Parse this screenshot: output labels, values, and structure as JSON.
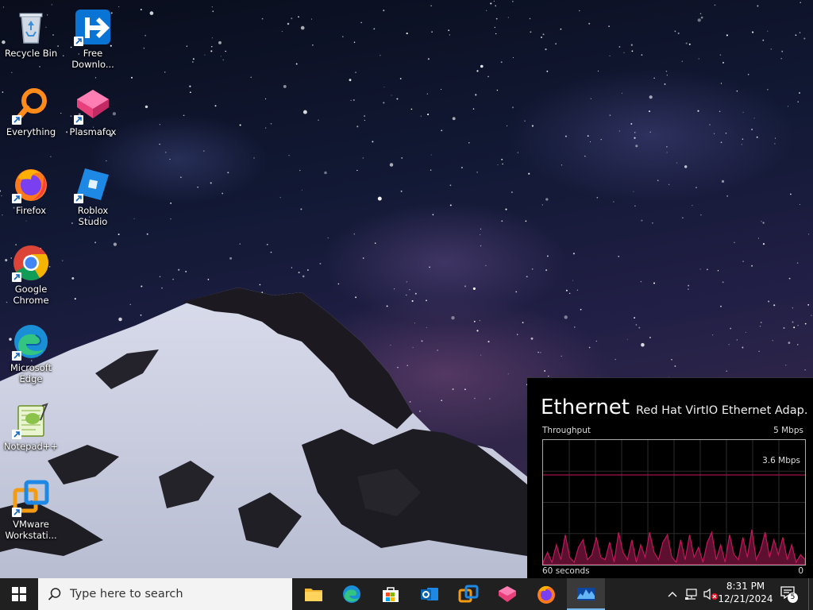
{
  "desktop_icons": [
    {
      "label": "Recycle Bin"
    },
    {
      "label": "Free Downlo..."
    },
    {
      "label": "Everything"
    },
    {
      "label": "Plasmafox"
    },
    {
      "label": "Firefox"
    },
    {
      "label": "Roblox Studio"
    },
    {
      "label": "Google Chrome"
    },
    {
      "label": "Microsoft Edge"
    },
    {
      "label": "Notepad++"
    },
    {
      "label": "VMware Workstati..."
    }
  ],
  "network_flyout": {
    "title": "Ethernet",
    "adapter": "Red Hat VirtIO Ethernet Adap...",
    "throughput_label": "Throughput",
    "max_label": "5 Mbps",
    "current_label": "3.6 Mbps",
    "time_label": "60 seconds",
    "min_label": "0",
    "scale_max_mbps": 5,
    "current_mbps": 3.6,
    "samples_mbps": [
      0.1,
      0.5,
      0.1,
      0.8,
      0.2,
      1.2,
      0.3,
      0.1,
      0.7,
      1.0,
      0.2,
      0.4,
      1.1,
      0.3,
      0.2,
      0.9,
      0.1,
      1.3,
      0.5,
      0.2,
      1.0,
      0.1,
      0.8,
      0.3,
      1.3,
      0.5,
      0.2,
      0.9,
      1.2,
      0.3,
      0.1,
      1.0,
      0.2,
      1.2,
      0.3,
      0.7,
      0.1,
      0.9,
      1.3,
      0.2,
      0.8,
      0.1,
      1.2,
      0.4,
      0.2,
      1.1,
      0.3,
      1.4,
      0.2,
      0.6,
      1.3,
      0.3,
      1.0,
      0.4,
      1.1,
      0.2,
      0.8,
      0.1,
      0.4,
      0.2
    ]
  },
  "taskbar": {
    "search_placeholder": "Type here to search",
    "pinned": [
      "File Explorer",
      "Microsoft Edge",
      "Microsoft Store",
      "Outlook",
      "VMware Workstation",
      "Plasmafox",
      "Firefox",
      "Network Monitor"
    ]
  },
  "clock": {
    "time": "8:31 PM",
    "date": "12/21/2024"
  },
  "notifications": {
    "count": "5"
  },
  "colors": {
    "graph_line": "#c2185b",
    "graph_fill": "#5c0f2e",
    "accent": "#76b9ed"
  }
}
